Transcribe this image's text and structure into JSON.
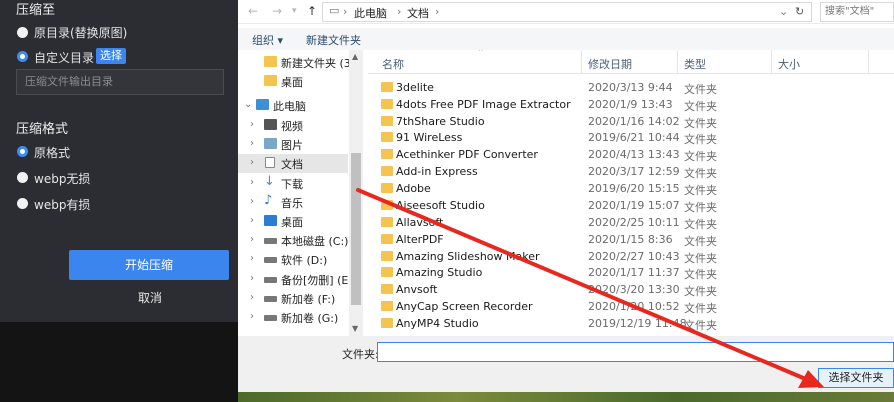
{
  "compress_app": {
    "section_save": "压缩至",
    "option_original_dir": "原目录(替换原图)",
    "option_custom_dir": "自定义目录",
    "choose_button": "选择",
    "output_placeholder": "压缩文件输出目录",
    "section_format": "压缩格式",
    "format_original": "原格式",
    "format_webp_lossless": "webp无损",
    "format_webp_lossy": "webp有损",
    "start_button": "开始压缩",
    "cancel_button": "取消"
  },
  "dialog": {
    "breadcrumb": [
      "此电脑",
      "文档"
    ],
    "search_placeholder": "搜索\"文档\"",
    "toolbar": {
      "organize": "组织 ▾",
      "new_folder": "新建文件夹"
    },
    "tree": [
      {
        "label": "新建文件夹 (3)",
        "icon": "folder-icon"
      },
      {
        "label": "桌面",
        "icon": "folder-icon"
      },
      {
        "label": "此电脑",
        "icon": "pc-icon"
      },
      {
        "label": "视频",
        "icon": "video-icon"
      },
      {
        "label": "图片",
        "icon": "picture-icon"
      },
      {
        "label": "文档",
        "icon": "document-icon"
      },
      {
        "label": "下载",
        "icon": "download-icon"
      },
      {
        "label": "音乐",
        "icon": "music-icon"
      },
      {
        "label": "桌面",
        "icon": "desktop-icon"
      },
      {
        "label": "本地磁盘 (C:)",
        "icon": "drive-icon"
      },
      {
        "label": "软件 (D:)",
        "icon": "drive-icon"
      },
      {
        "label": "备份[勿删] (E:)",
        "icon": "drive-icon"
      },
      {
        "label": "新加卷 (F:)",
        "icon": "drive-icon"
      },
      {
        "label": "新加卷 (G:)",
        "icon": "drive-icon"
      }
    ],
    "columns": {
      "name": "名称",
      "date": "修改日期",
      "type": "类型",
      "size": "大小"
    },
    "files": [
      {
        "name": "3delite",
        "date": "2020/3/13 9:44",
        "type": "文件夹"
      },
      {
        "name": "4dots Free PDF Image Extractor",
        "date": "2020/1/9 13:43",
        "type": "文件夹"
      },
      {
        "name": "7thShare Studio",
        "date": "2020/1/16 14:02",
        "type": "文件夹"
      },
      {
        "name": "91 WireLess",
        "date": "2019/6/21 10:44",
        "type": "文件夹"
      },
      {
        "name": "Acethinker PDF Converter",
        "date": "2020/4/13 13:43",
        "type": "文件夹"
      },
      {
        "name": "Add-in Express",
        "date": "2020/3/17 12:59",
        "type": "文件夹"
      },
      {
        "name": "Adobe",
        "date": "2019/6/20 15:15",
        "type": "文件夹"
      },
      {
        "name": "Aiseesoft Studio",
        "date": "2020/1/19 15:07",
        "type": "文件夹"
      },
      {
        "name": "Allavsoft",
        "date": "2020/2/25 10:11",
        "type": "文件夹"
      },
      {
        "name": "AlterPDF",
        "date": "2020/1/15 8:36",
        "type": "文件夹"
      },
      {
        "name": "Amazing Slideshow Maker",
        "date": "2020/2/27 10:43",
        "type": "文件夹"
      },
      {
        "name": "Amazing Studio",
        "date": "2020/1/17 11:37",
        "type": "文件夹"
      },
      {
        "name": "Anvsoft",
        "date": "2020/3/20 13:30",
        "type": "文件夹"
      },
      {
        "name": "AnyCap Screen Recorder",
        "date": "2020/1/20 10:52",
        "type": "文件夹"
      },
      {
        "name": "AnyMP4 Studio",
        "date": "2019/12/19 11:48",
        "type": "文件夹"
      }
    ],
    "folder_label": "文件夹:",
    "folder_value": "",
    "select_folder_button": "选择文件夹"
  },
  "colors": {
    "accent": "#3a86ee",
    "annotation_arrow": "#e8271f",
    "dark_panel": "#2b2d33",
    "folder": "#f5c450"
  }
}
